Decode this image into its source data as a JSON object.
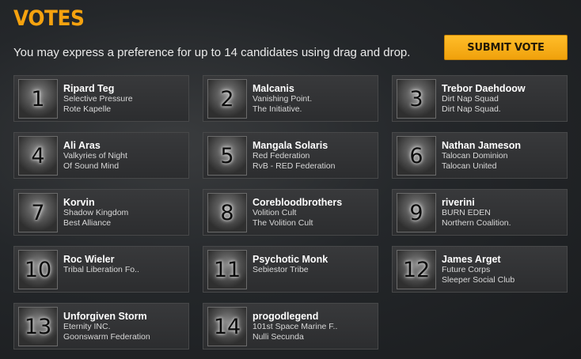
{
  "header": {
    "title": "VOTES",
    "subtitle": "You may express a preference for up to 14 candidates using drag and drop.",
    "submit_label": "SUBMIT VOTE"
  },
  "candidates": [
    {
      "rank": "1",
      "name": "Ripard Teg",
      "corp": "Selective Pressure",
      "alliance": "Rote Kapelle"
    },
    {
      "rank": "2",
      "name": "Malcanis",
      "corp": "Vanishing Point.",
      "alliance": "The Initiative."
    },
    {
      "rank": "3",
      "name": "Trebor Daehdoow",
      "corp": "Dirt Nap Squad",
      "alliance": "Dirt Nap Squad."
    },
    {
      "rank": "4",
      "name": "Ali Aras",
      "corp": "Valkyries of Night",
      "alliance": "Of Sound Mind"
    },
    {
      "rank": "5",
      "name": "Mangala Solaris",
      "corp": "Red Federation",
      "alliance": "RvB - RED Federation"
    },
    {
      "rank": "6",
      "name": "Nathan Jameson",
      "corp": "Talocan Dominion",
      "alliance": "Talocan United"
    },
    {
      "rank": "7",
      "name": "Korvin",
      "corp": "Shadow Kingdom",
      "alliance": "Best Alliance"
    },
    {
      "rank": "8",
      "name": "Corebloodbrothers",
      "corp": "Volition Cult",
      "alliance": "The Volition Cult"
    },
    {
      "rank": "9",
      "name": "riverini",
      "corp": "BURN EDEN",
      "alliance": "Northern Coalition."
    },
    {
      "rank": "10",
      "name": "Roc Wieler",
      "corp": "Tribal Liberation Fo..",
      "alliance": ""
    },
    {
      "rank": "11",
      "name": "Psychotic Monk",
      "corp": "Sebiestor Tribe",
      "alliance": ""
    },
    {
      "rank": "12",
      "name": "James Arget",
      "corp": "Future Corps",
      "alliance": "Sleeper Social Club"
    },
    {
      "rank": "13",
      "name": "Unforgiven Storm",
      "corp": "Eternity INC.",
      "alliance": "Goonswarm Federation"
    },
    {
      "rank": "14",
      "name": "progodlegend",
      "corp": "101st Space Marine F..",
      "alliance": "Nulli Secunda"
    }
  ]
}
